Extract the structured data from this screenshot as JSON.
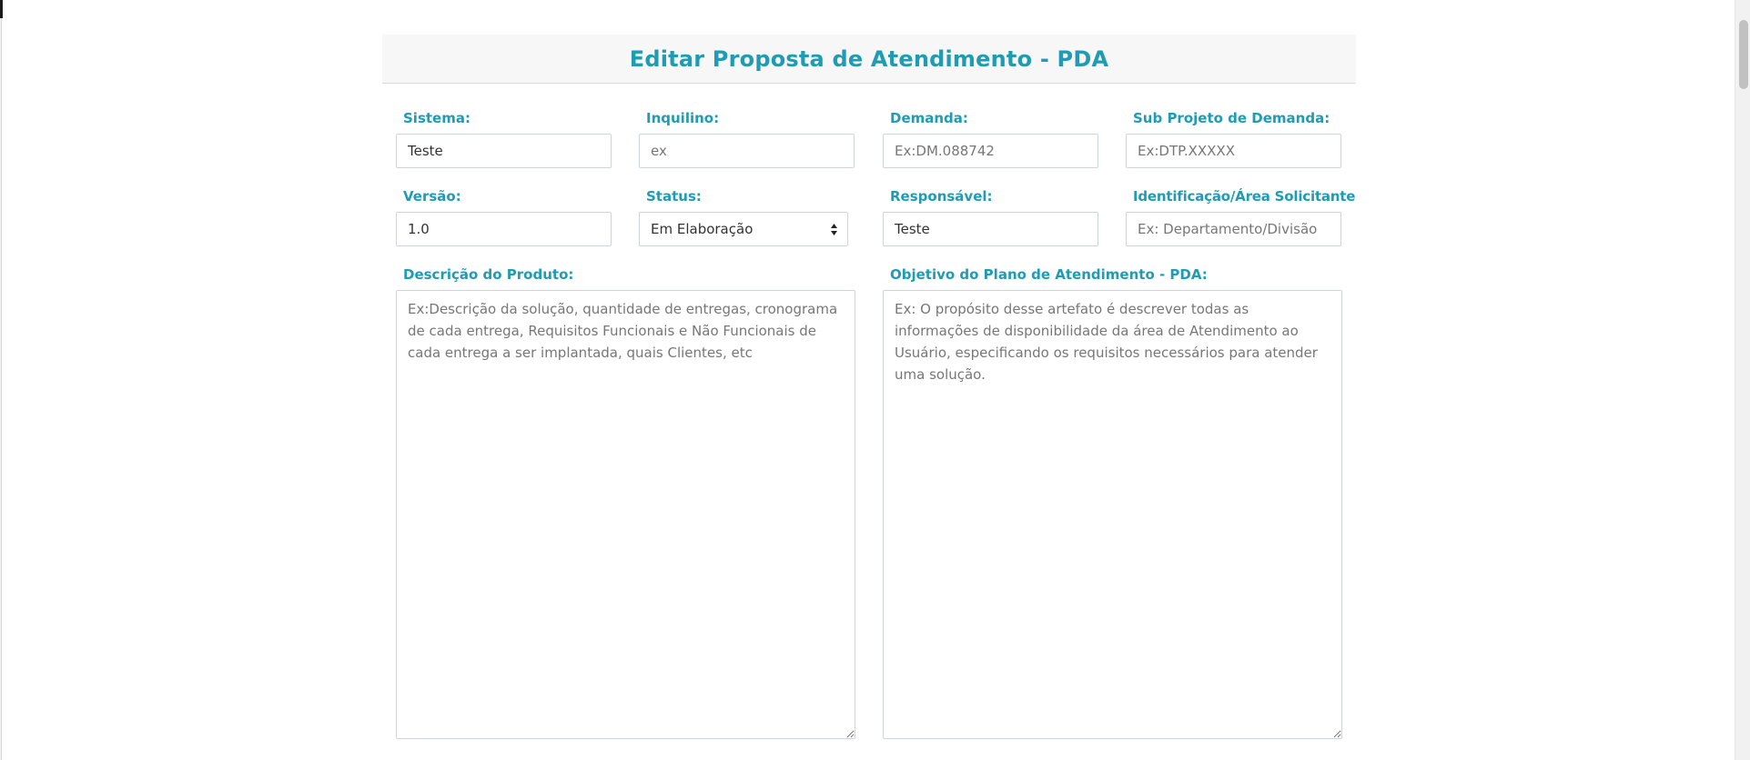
{
  "form": {
    "title": "Editar Proposta de Atendimento - PDA",
    "fields": {
      "sistema": {
        "label": "Sistema:",
        "value": "Teste",
        "placeholder": ""
      },
      "inquilino": {
        "label": "Inquilino:",
        "value": "",
        "placeholder": "ex"
      },
      "demanda": {
        "label": "Demanda:",
        "value": "",
        "placeholder": "Ex:DM.088742"
      },
      "sub_projeto": {
        "label": "Sub Projeto de Demanda:",
        "value": "",
        "placeholder": "Ex:DTP.XXXXX"
      },
      "versao": {
        "label": "Versão:",
        "value": "1.0",
        "placeholder": ""
      },
      "status": {
        "label": "Status:",
        "selected": "Em Elaboração"
      },
      "responsavel": {
        "label": "Responsável:",
        "value": "Teste",
        "placeholder": ""
      },
      "identificacao": {
        "label": "Identificação/Área Solicitante",
        "value": "",
        "placeholder": "Ex: Departamento/Divisão"
      },
      "descricao": {
        "label": "Descrição do Produto:",
        "value": "",
        "placeholder": "Ex:Descrição da solução, quantidade de entregas, cronograma de cada entrega, Requisitos Funcionais e Não Funcionais de cada entrega a ser implantada, quais Clientes, etc"
      },
      "objetivo": {
        "label": "Objetivo do Plano de Atendimento - PDA:",
        "value": "",
        "placeholder": "Ex: O propósito desse artefato é descrever todas as informações de disponibilidade da área de Atendimento ao Usuário, especificando os requisitos necessários para atender uma solução."
      }
    }
  },
  "icons": {
    "select_arrow": "select-arrows-icon",
    "resize_handle": "resize-grip-icon"
  },
  "colors": {
    "accent": "#1f9cb3",
    "header_bg": "#f7f7f7",
    "border": "#ced4da"
  }
}
